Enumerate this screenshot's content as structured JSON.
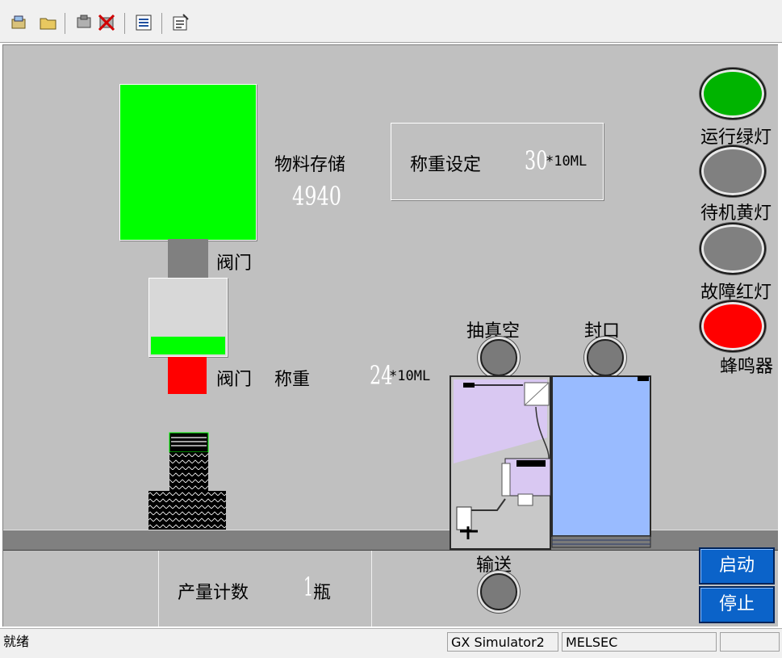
{
  "toolbar": {
    "buttons": [
      "open-icon",
      "folder-icon",
      "telephone-icon",
      "disconnect-icon",
      "list-icon",
      "properties-icon"
    ]
  },
  "hmi": {
    "storage": {
      "label": "物料存储",
      "value": "4940"
    },
    "weight_setting": {
      "label": "称重设定",
      "value": "30",
      "unit": "*10ML"
    },
    "valve_top_label": "阀门",
    "valve_bottom_label": "阀门",
    "weigh": {
      "label": "称重",
      "value": "24",
      "unit": "*10ML"
    },
    "vacuum_label": "抽真空",
    "seal_label": "封口",
    "conveyor_label": "输送",
    "production": {
      "label": "产量计数",
      "value": "1",
      "unit": "瓶"
    },
    "lights": [
      {
        "label": "运行绿灯",
        "color": "#00b400"
      },
      {
        "label": "待机黄灯",
        "color": "#808080"
      },
      {
        "label": "故障红灯",
        "color": "#808080"
      },
      {
        "label": "蜂鸣器",
        "color": "#ff0000"
      }
    ],
    "start_button": "启动",
    "stop_button": "停止",
    "colors": {
      "storage": "#00ff00",
      "valve_top": "#808080",
      "valve_bottom": "#ff0000",
      "machine_body": "#99bbff",
      "machine_panel": "#d9c8f2",
      "button": "#0b63c9"
    }
  },
  "status": {
    "ready": "就绪",
    "simulator": "GX Simulator2",
    "melsec": "MELSEC"
  }
}
